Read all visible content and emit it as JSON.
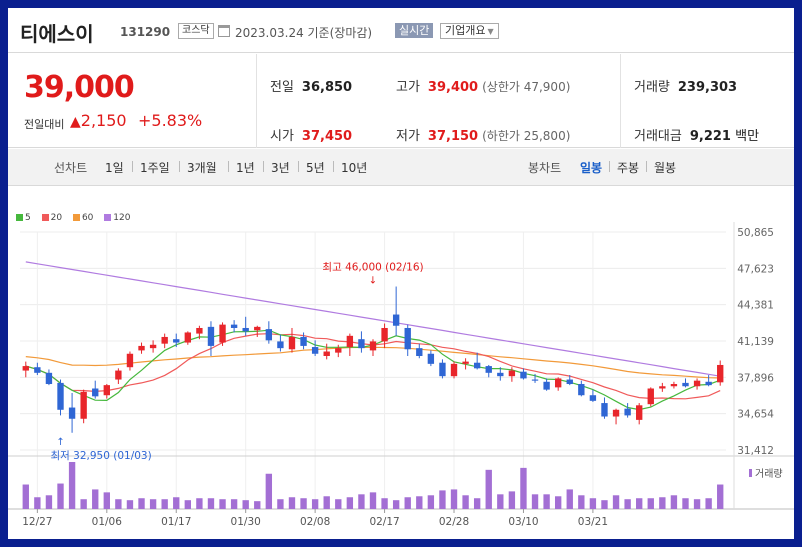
{
  "header": {
    "stock_name": "티에스이",
    "stock_code": "131290",
    "market": "코스닥",
    "as_of": "2023.03.24 기준(장마감)",
    "realtime_label": "실시간",
    "overview_label": "기업개요"
  },
  "summary": {
    "price": "39,000",
    "change_label": "전일대비",
    "change_amount": "2,150",
    "change_percent": "+5.83%",
    "prev_label": "전일",
    "prev_value": "36,850",
    "open_label": "시가",
    "open_value": "37,450",
    "high_label": "고가",
    "high_value": "39,400",
    "upper_limit_text": "(상한가 47,900)",
    "low_label": "저가",
    "low_value": "37,150",
    "lower_limit_text": "(하한가 25,800)",
    "volume_label": "거래량",
    "volume_value": "239,303",
    "amount_label": "거래대금",
    "amount_value": "9,221",
    "amount_unit": "백만"
  },
  "tabs": {
    "line_chart_label": "선차트",
    "line_periods": [
      "1일",
      "1주일",
      "3개월",
      "1년",
      "3년",
      "5년",
      "10년"
    ],
    "candle_chart_label": "봉차트",
    "candle_periods": [
      "일봉",
      "주봉",
      "월봉"
    ],
    "active_candle_period": "일봉"
  },
  "colors": {
    "up": "#e8262b",
    "down": "#2f66d4",
    "ma5": "#46b83d",
    "ma20": "#f05a5a",
    "ma60": "#f29a3a",
    "ma120": "#b07be0",
    "volume": "#a36fd4"
  },
  "chart_data": {
    "type": "candlestick",
    "legend": [
      "5",
      "20",
      "60",
      "120"
    ],
    "volume_label": "거래량",
    "y_ticks": [
      "50,865",
      "47,623",
      "44,381",
      "41,139",
      "37,896",
      "34,654",
      "31,412"
    ],
    "ylim": [
      31412,
      50865
    ],
    "x_labels": [
      {
        "index": 1,
        "label": "12/27"
      },
      {
        "index": 7,
        "label": "01/06"
      },
      {
        "index": 13,
        "label": "01/17"
      },
      {
        "index": 19,
        "label": "01/30"
      },
      {
        "index": 25,
        "label": "02/08"
      },
      {
        "index": 31,
        "label": "02/17"
      },
      {
        "index": 37,
        "label": "02/28"
      },
      {
        "index": 43,
        "label": "03/10"
      },
      {
        "index": 49,
        "label": "03/21"
      }
    ],
    "annotations": {
      "high": {
        "index": 30,
        "value": 46000,
        "text": "최고 46,000 (02/16)"
      },
      "low": {
        "index": 3,
        "value": 32950,
        "text": "최저 32,950 (01/03)"
      }
    },
    "candles": [
      {
        "o": 38500,
        "h": 39300,
        "l": 37900,
        "c": 38900
      },
      {
        "o": 38800,
        "h": 39200,
        "l": 38100,
        "c": 38300
      },
      {
        "o": 38300,
        "h": 38600,
        "l": 37200,
        "c": 37300
      },
      {
        "o": 37400,
        "h": 37700,
        "l": 34500,
        "c": 35000
      },
      {
        "o": 35200,
        "h": 36500,
        "l": 32950,
        "c": 34200
      },
      {
        "o": 34200,
        "h": 36800,
        "l": 33800,
        "c": 36600
      },
      {
        "o": 36900,
        "h": 37600,
        "l": 36000,
        "c": 36200
      },
      {
        "o": 36300,
        "h": 37300,
        "l": 36000,
        "c": 37200
      },
      {
        "o": 37700,
        "h": 38700,
        "l": 37300,
        "c": 38500
      },
      {
        "o": 38800,
        "h": 40200,
        "l": 38500,
        "c": 40000
      },
      {
        "o": 40300,
        "h": 41000,
        "l": 40000,
        "c": 40700
      },
      {
        "o": 40500,
        "h": 41200,
        "l": 40100,
        "c": 40800
      },
      {
        "o": 40900,
        "h": 41800,
        "l": 40500,
        "c": 41500
      },
      {
        "o": 41300,
        "h": 41800,
        "l": 40600,
        "c": 41000
      },
      {
        "o": 41000,
        "h": 42000,
        "l": 40800,
        "c": 41900
      },
      {
        "o": 41800,
        "h": 42500,
        "l": 41300,
        "c": 42300
      },
      {
        "o": 42400,
        "h": 42900,
        "l": 39800,
        "c": 40700
      },
      {
        "o": 41000,
        "h": 42800,
        "l": 40700,
        "c": 42600
      },
      {
        "o": 42600,
        "h": 43000,
        "l": 41900,
        "c": 42300
      },
      {
        "o": 42300,
        "h": 43300,
        "l": 41600,
        "c": 42000
      },
      {
        "o": 42100,
        "h": 42500,
        "l": 41500,
        "c": 42400
      },
      {
        "o": 42200,
        "h": 42900,
        "l": 40900,
        "c": 41200
      },
      {
        "o": 41100,
        "h": 41700,
        "l": 40200,
        "c": 40500
      },
      {
        "o": 40400,
        "h": 42300,
        "l": 40100,
        "c": 41500
      },
      {
        "o": 41500,
        "h": 41900,
        "l": 40400,
        "c": 40700
      },
      {
        "o": 40600,
        "h": 41200,
        "l": 39800,
        "c": 40000
      },
      {
        "o": 39800,
        "h": 40900,
        "l": 39500,
        "c": 40200
      },
      {
        "o": 40100,
        "h": 40800,
        "l": 39700,
        "c": 40500
      },
      {
        "o": 40600,
        "h": 41800,
        "l": 39800,
        "c": 41600
      },
      {
        "o": 41300,
        "h": 42000,
        "l": 40100,
        "c": 40500
      },
      {
        "o": 40300,
        "h": 41300,
        "l": 39800,
        "c": 41100
      },
      {
        "o": 41100,
        "h": 42700,
        "l": 40500,
        "c": 42300
      },
      {
        "o": 43500,
        "h": 46000,
        "l": 41600,
        "c": 42500
      },
      {
        "o": 42300,
        "h": 42600,
        "l": 39800,
        "c": 40400
      },
      {
        "o": 40500,
        "h": 40900,
        "l": 39600,
        "c": 39800
      },
      {
        "o": 40000,
        "h": 40300,
        "l": 38900,
        "c": 39100
      },
      {
        "o": 39200,
        "h": 39500,
        "l": 37800,
        "c": 38000
      },
      {
        "o": 38000,
        "h": 39300,
        "l": 37800,
        "c": 39100
      },
      {
        "o": 39100,
        "h": 39600,
        "l": 38600,
        "c": 39300
      },
      {
        "o": 39200,
        "h": 40100,
        "l": 38600,
        "c": 38700
      },
      {
        "o": 38900,
        "h": 39000,
        "l": 37900,
        "c": 38300
      },
      {
        "o": 38300,
        "h": 38800,
        "l": 37600,
        "c": 38000
      },
      {
        "o": 38000,
        "h": 38800,
        "l": 37500,
        "c": 38500
      },
      {
        "o": 38400,
        "h": 38700,
        "l": 37700,
        "c": 37800
      },
      {
        "o": 37700,
        "h": 38200,
        "l": 37400,
        "c": 37600
      },
      {
        "o": 37500,
        "h": 37800,
        "l": 36700,
        "c": 36800
      },
      {
        "o": 37000,
        "h": 37900,
        "l": 36700,
        "c": 37800
      },
      {
        "o": 37700,
        "h": 38100,
        "l": 37200,
        "c": 37300
      },
      {
        "o": 37300,
        "h": 37600,
        "l": 36200,
        "c": 36300
      },
      {
        "o": 36300,
        "h": 36800,
        "l": 35700,
        "c": 35800
      },
      {
        "o": 35600,
        "h": 36100,
        "l": 34200,
        "c": 34400
      },
      {
        "o": 34400,
        "h": 35100,
        "l": 33700,
        "c": 35000
      },
      {
        "o": 35100,
        "h": 35600,
        "l": 34300,
        "c": 34500
      },
      {
        "o": 34100,
        "h": 35600,
        "l": 33700,
        "c": 35400
      },
      {
        "o": 35500,
        "h": 37000,
        "l": 35300,
        "c": 36900
      },
      {
        "o": 36900,
        "h": 37400,
        "l": 36600,
        "c": 37100
      },
      {
        "o": 37100,
        "h": 37500,
        "l": 36900,
        "c": 37300
      },
      {
        "o": 37400,
        "h": 37800,
        "l": 37000,
        "c": 37100
      },
      {
        "o": 37100,
        "h": 37800,
        "l": 36800,
        "c": 37600
      },
      {
        "o": 37500,
        "h": 38100,
        "l": 37100,
        "c": 37200
      },
      {
        "o": 37450,
        "h": 39400,
        "l": 37150,
        "c": 39000
      }
    ],
    "volumes": [
      25,
      12,
      14,
      26,
      48,
      10,
      20,
      17,
      10,
      9,
      11,
      10,
      10,
      12,
      9,
      11,
      11,
      10,
      10,
      9,
      8,
      36,
      10,
      12,
      11,
      10,
      13,
      10,
      12,
      15,
      17,
      11,
      9,
      12,
      13,
      14,
      19,
      20,
      14,
      11,
      40,
      15,
      18,
      42,
      15,
      15,
      13,
      20,
      14,
      11,
      9,
      14,
      10,
      11,
      11,
      12,
      14,
      11,
      10,
      11,
      25
    ]
  }
}
